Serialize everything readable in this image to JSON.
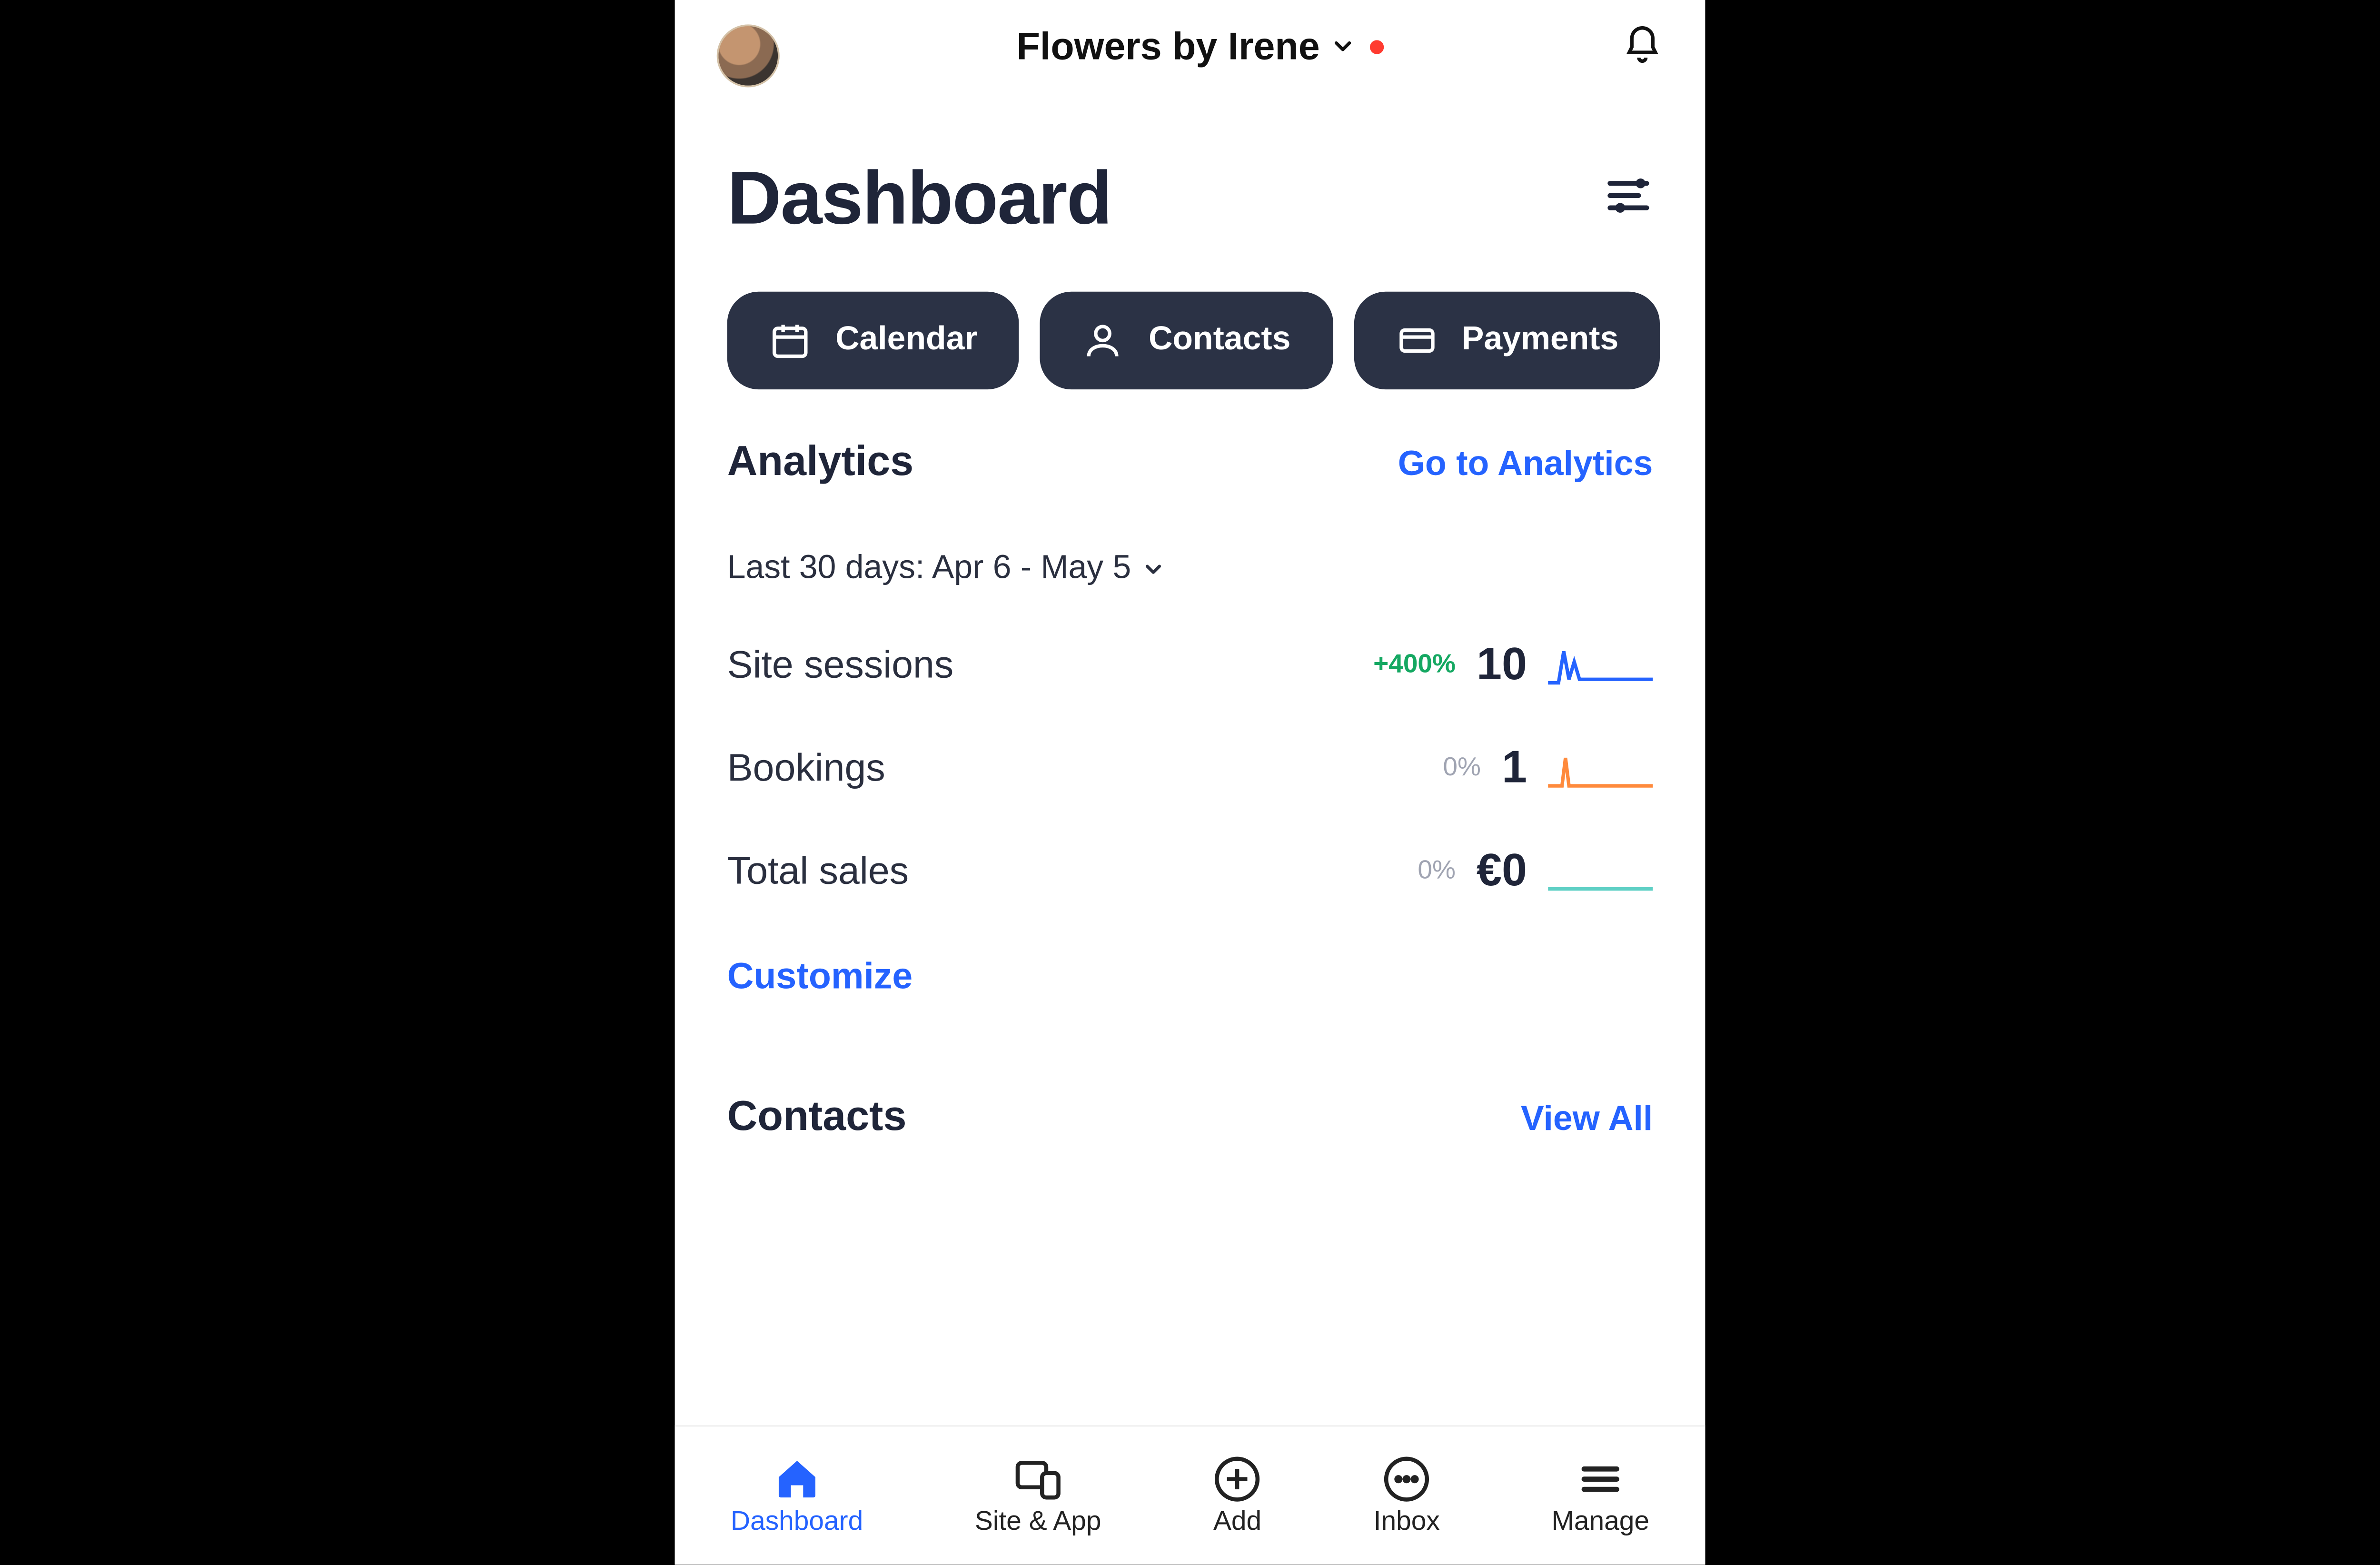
{
  "header": {
    "site_name": "Flowers by Irene",
    "has_notification_dot": true
  },
  "page": {
    "title": "Dashboard"
  },
  "shortcuts": [
    {
      "icon": "calendar-icon",
      "label": "Calendar"
    },
    {
      "icon": "contacts-icon",
      "label": "Contacts"
    },
    {
      "icon": "payments-icon",
      "label": "Payments"
    }
  ],
  "analytics": {
    "section_title": "Analytics",
    "link_label": "Go to Analytics",
    "date_range": "Last 30 days: Apr 6 - May 5",
    "metrics": [
      {
        "label": "Site sessions",
        "change": "+400%",
        "change_style": "green",
        "value": "10",
        "spark_color": "#2563ff"
      },
      {
        "label": "Bookings",
        "change": "0%",
        "change_style": "muted",
        "value": "1",
        "spark_color": "#ff8a3c"
      },
      {
        "label": "Total sales",
        "change": "0%",
        "change_style": "muted",
        "value": "€0",
        "spark_color": "#5fd0c5"
      }
    ],
    "customize_label": "Customize"
  },
  "contacts": {
    "section_title": "Contacts",
    "link_label": "View All"
  },
  "tabs": [
    {
      "label": "Dashboard",
      "icon": "home-icon",
      "active": true
    },
    {
      "label": "Site & App",
      "icon": "devices-icon",
      "active": false
    },
    {
      "label": "Add",
      "icon": "plus-circle-icon",
      "active": false
    },
    {
      "label": "Inbox",
      "icon": "chat-icon",
      "active": false
    },
    {
      "label": "Manage",
      "icon": "menu-icon",
      "active": false
    }
  ]
}
